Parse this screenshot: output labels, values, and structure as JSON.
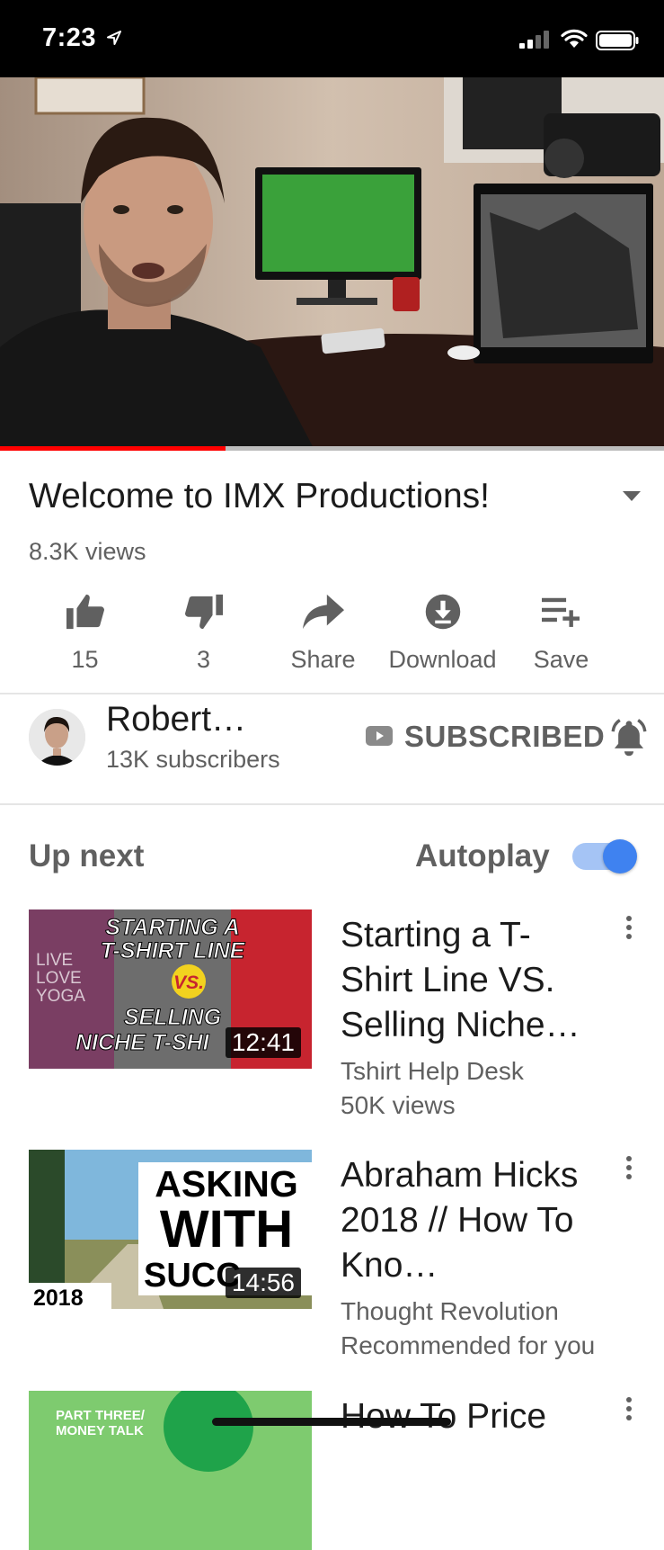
{
  "status_bar": {
    "time": "7:23"
  },
  "video": {
    "title": "Welcome to IMX Productions!",
    "views": "8.3K views",
    "progress": 0.34
  },
  "actions": [
    {
      "icon": "thumbs-up-icon",
      "label": "15"
    },
    {
      "icon": "thumbs-down-icon",
      "label": "3"
    },
    {
      "icon": "share-icon",
      "label": "Share"
    },
    {
      "icon": "download-icon",
      "label": "Download"
    },
    {
      "icon": "save-playlist-icon",
      "label": "Save"
    }
  ],
  "channel": {
    "name": "Robert…",
    "subscribers": "13K subscribers",
    "subscribe_label": "SUBSCRIBED"
  },
  "up_next": {
    "label": "Up next",
    "autoplay_label": "Autoplay",
    "autoplay_on": true
  },
  "recommendations": [
    {
      "title": "Starting a T-Shirt Line VS. Selling Niche…",
      "channel": "Tshirt Help Desk",
      "meta": "50K views",
      "duration": "12:41",
      "thumb_text": [
        "STARTING A",
        "T-SHIRT LINE",
        "VS.",
        "SELLING",
        "NICHE T-SHI",
        "LIVE",
        "LOVE",
        "YOGA"
      ]
    },
    {
      "title": "Abraham Hicks 2018 // How To Kno…",
      "channel": "Thought Revolution",
      "meta": "Recommended for you",
      "duration": "14:56",
      "thumb_text": [
        "ASKING",
        "WITH",
        "SUCC",
        "2018"
      ]
    },
    {
      "title": "How To Price",
      "channel": "",
      "meta": "",
      "duration": "",
      "thumb_text": [
        "PART THREE/",
        "MONEY TALK"
      ]
    }
  ],
  "colors": {
    "progress": "#ff0000",
    "toggle_knob": "#3f82f0",
    "toggle_track": "#a5c4f5",
    "text_secondary": "#606060"
  }
}
